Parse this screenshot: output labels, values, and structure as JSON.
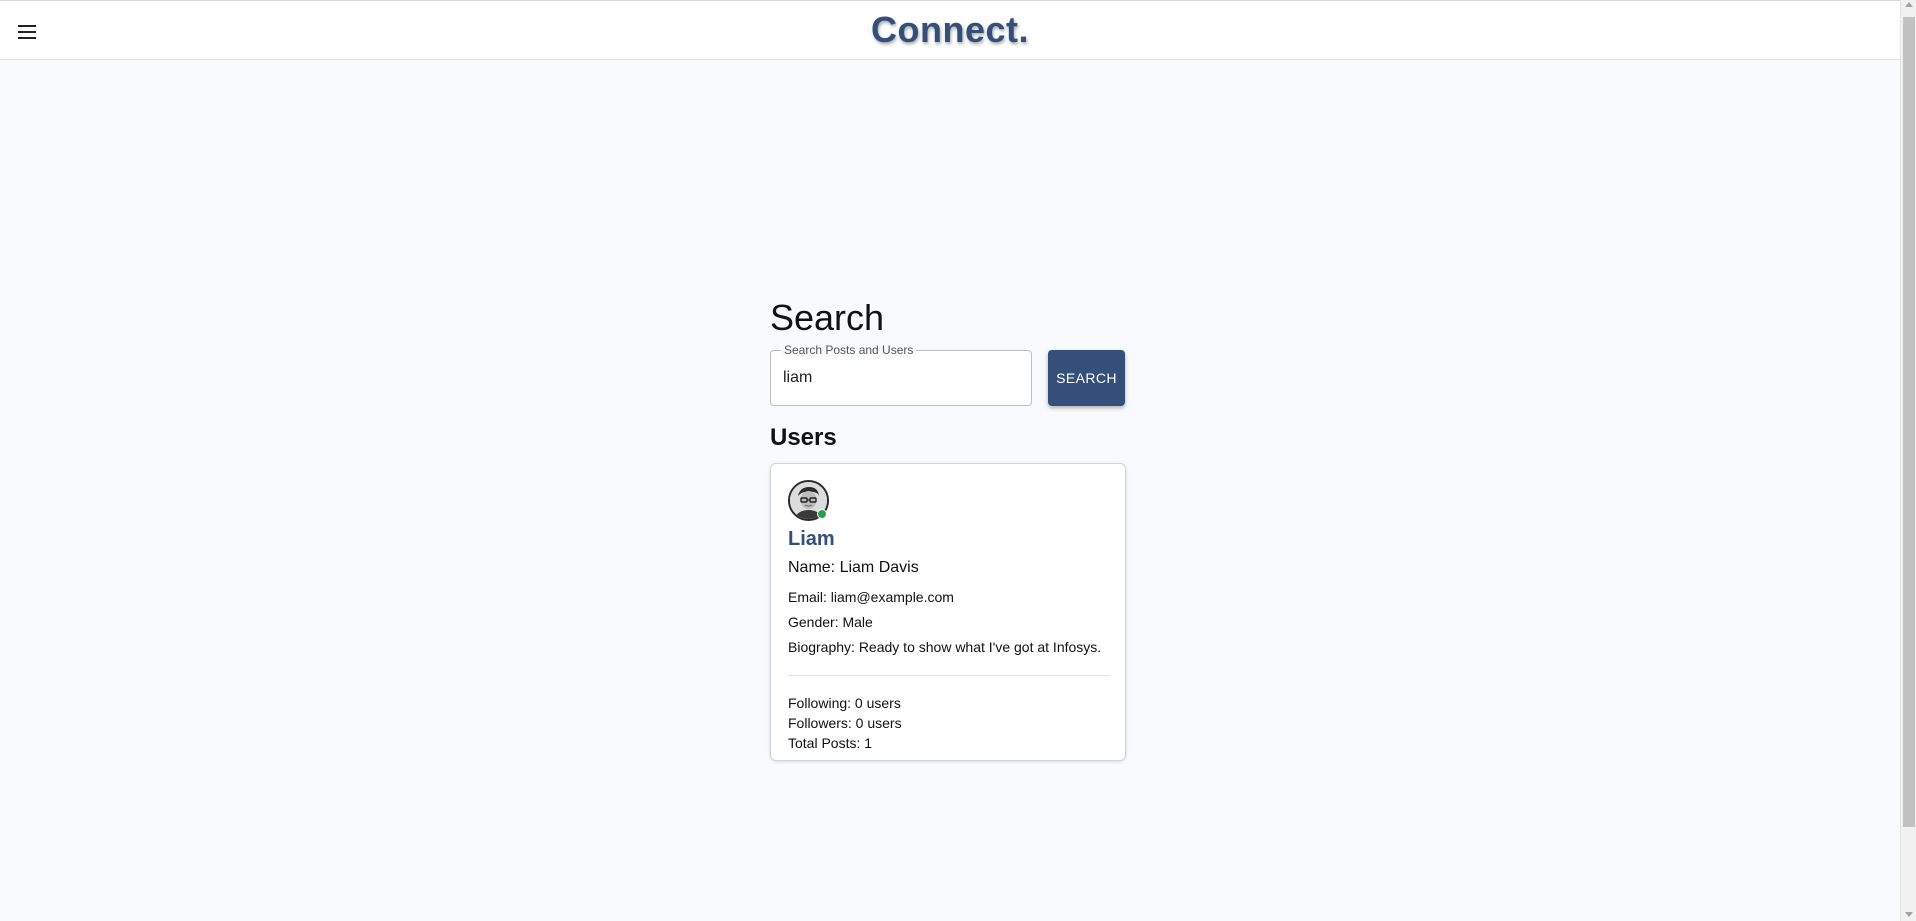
{
  "app": {
    "brand": "Connect.",
    "menu_icon": "hamburger-menu-icon"
  },
  "search": {
    "title": "Search",
    "field_label": "Search Posts and Users",
    "value": "liam",
    "button_label": "SEARCH"
  },
  "results": {
    "users_heading": "Users",
    "users": [
      {
        "username": "Liam",
        "name": "Name: Liam Davis",
        "email": "Email: liam@example.com",
        "gender": "Gender: Male",
        "biography": "Biography: Ready to show what I've got at Infosys.",
        "following": "Following: 0 users",
        "followers": "Followers: 0 users",
        "total_posts": "Total Posts: 1",
        "online": true
      }
    ]
  },
  "colors": {
    "brand": "#34507a",
    "background": "#f8fafd",
    "online": "#2e9d4e"
  }
}
